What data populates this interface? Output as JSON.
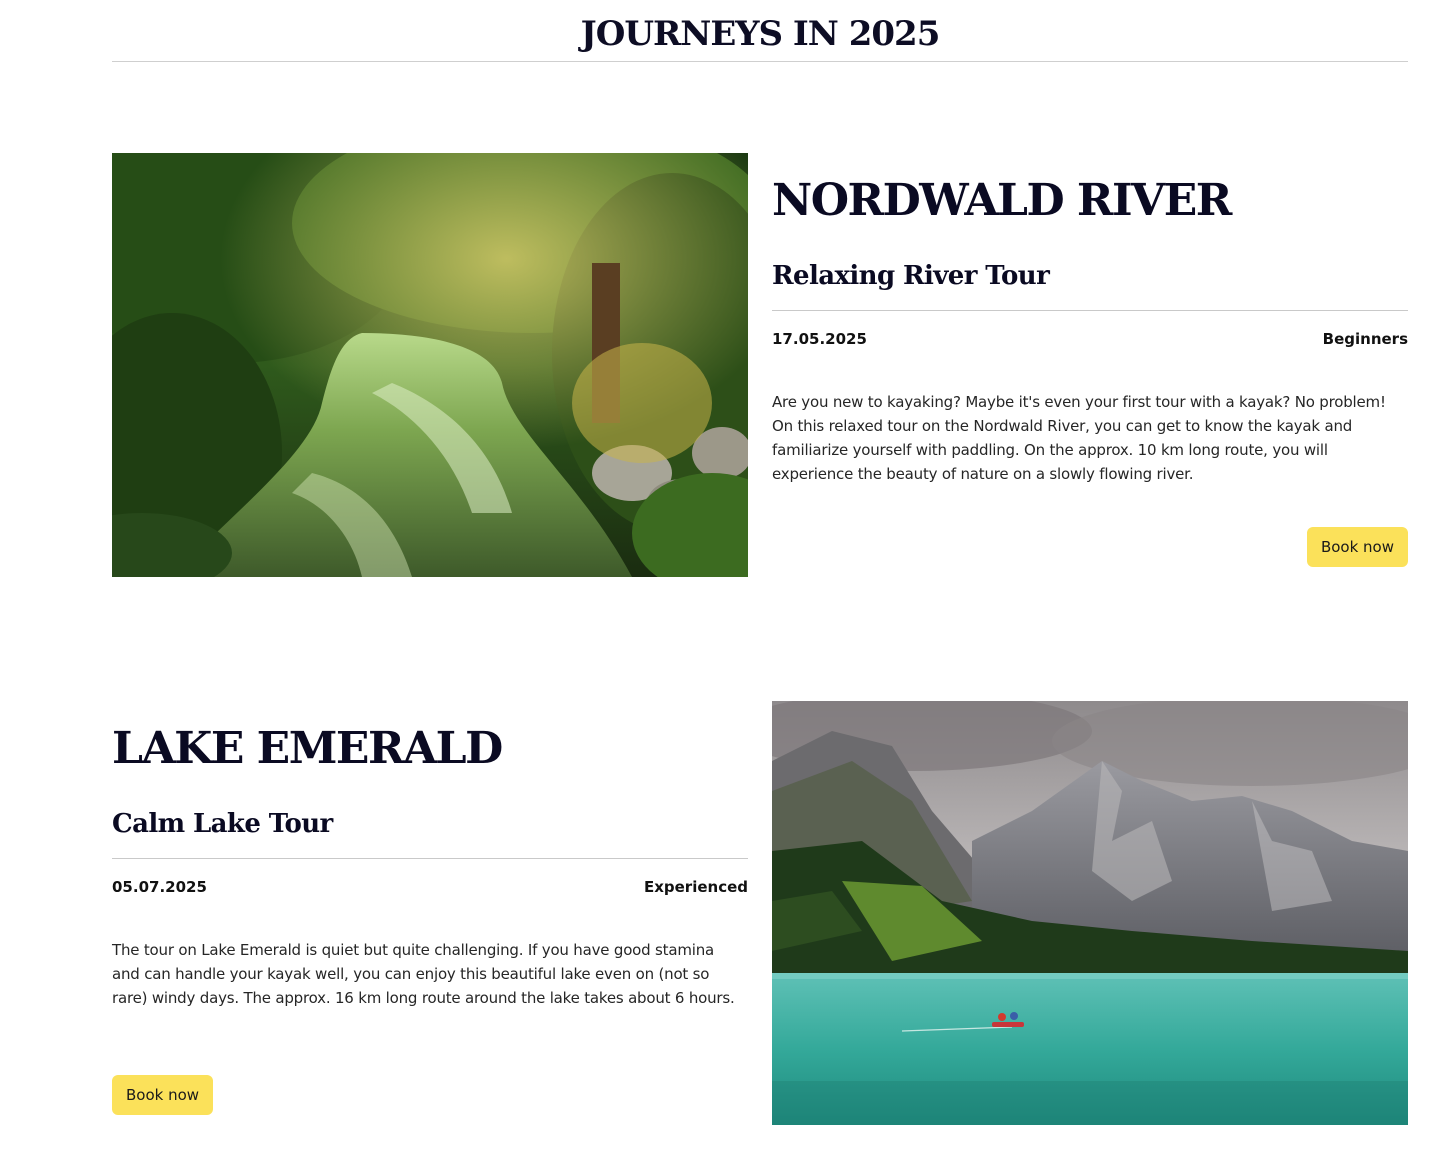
{
  "header": {
    "title": "JOURNEYS IN 2025"
  },
  "tours": [
    {
      "name": "NORDWALD RIVER",
      "subtitle": "Relaxing River Tour",
      "date": "17.05.2025",
      "level": "Beginners",
      "description": "Are you new to kayaking? Maybe it's even your first tour with a kayak? No problem! On this relaxed tour on the Nordwald River, you can get to know the kayak and familiarize yourself with paddling. On the approx. 10 km long route, you will experience the beauty of nature on a slowly flowing river.",
      "button_label": "Book now",
      "image": "forest-river-photo"
    },
    {
      "name": "LAKE EMERALD",
      "subtitle": "Calm Lake Tour",
      "date": "05.07.2025",
      "level": "Experienced",
      "description": "The tour on Lake Emerald is quiet but quite challenging. If you have good stamina and can handle your kayak well, you can enjoy this beautiful lake even on (not so rare) windy days. The approx. 16 km long route around the lake takes about 6 hours.",
      "button_label": "Book now",
      "image": "mountain-lake-photo"
    }
  ],
  "colors": {
    "accent_button": "#fbe15a",
    "heading": "#0a0a22",
    "divider": "#c9c9c9"
  }
}
